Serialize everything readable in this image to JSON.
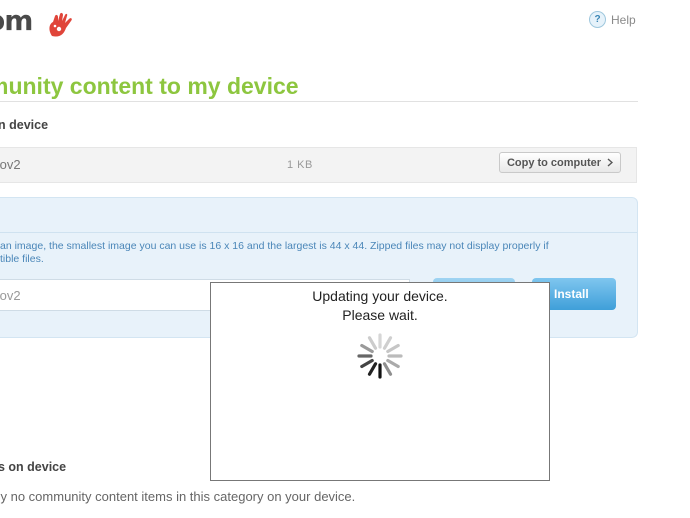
{
  "header": {
    "logo_text": "om",
    "help_label": "Help",
    "help_icon_glyph": "?"
  },
  "page": {
    "title": "munity content to my device"
  },
  "on_device": {
    "heading": "n device",
    "file_name": ".ov2",
    "file_size": "1 KB",
    "copy_button_label": "Copy to computer",
    "copy_button_icon": "chevron-right-icon"
  },
  "install_panel": {
    "info_line1": "an image, the smallest image you can use is 16 x 16 and the largest is 44 x 44. Zipped files may not display properly if",
    "info_line2": "tible files.",
    "file_input_value": ".ov2",
    "install_button_label": "Install"
  },
  "modal": {
    "line1": "Updating your device.",
    "line2": "Please wait.",
    "spinner_icon": "loading-spinner-icon"
  },
  "items_section": {
    "heading": "s on device",
    "empty_text": "tly no community content items in this category on your device."
  },
  "colors": {
    "accent_green": "#8dc63f",
    "panel_blue": "#e8f2fa",
    "button_blue": "#3f9fd9",
    "logo_red": "#e0453a"
  }
}
